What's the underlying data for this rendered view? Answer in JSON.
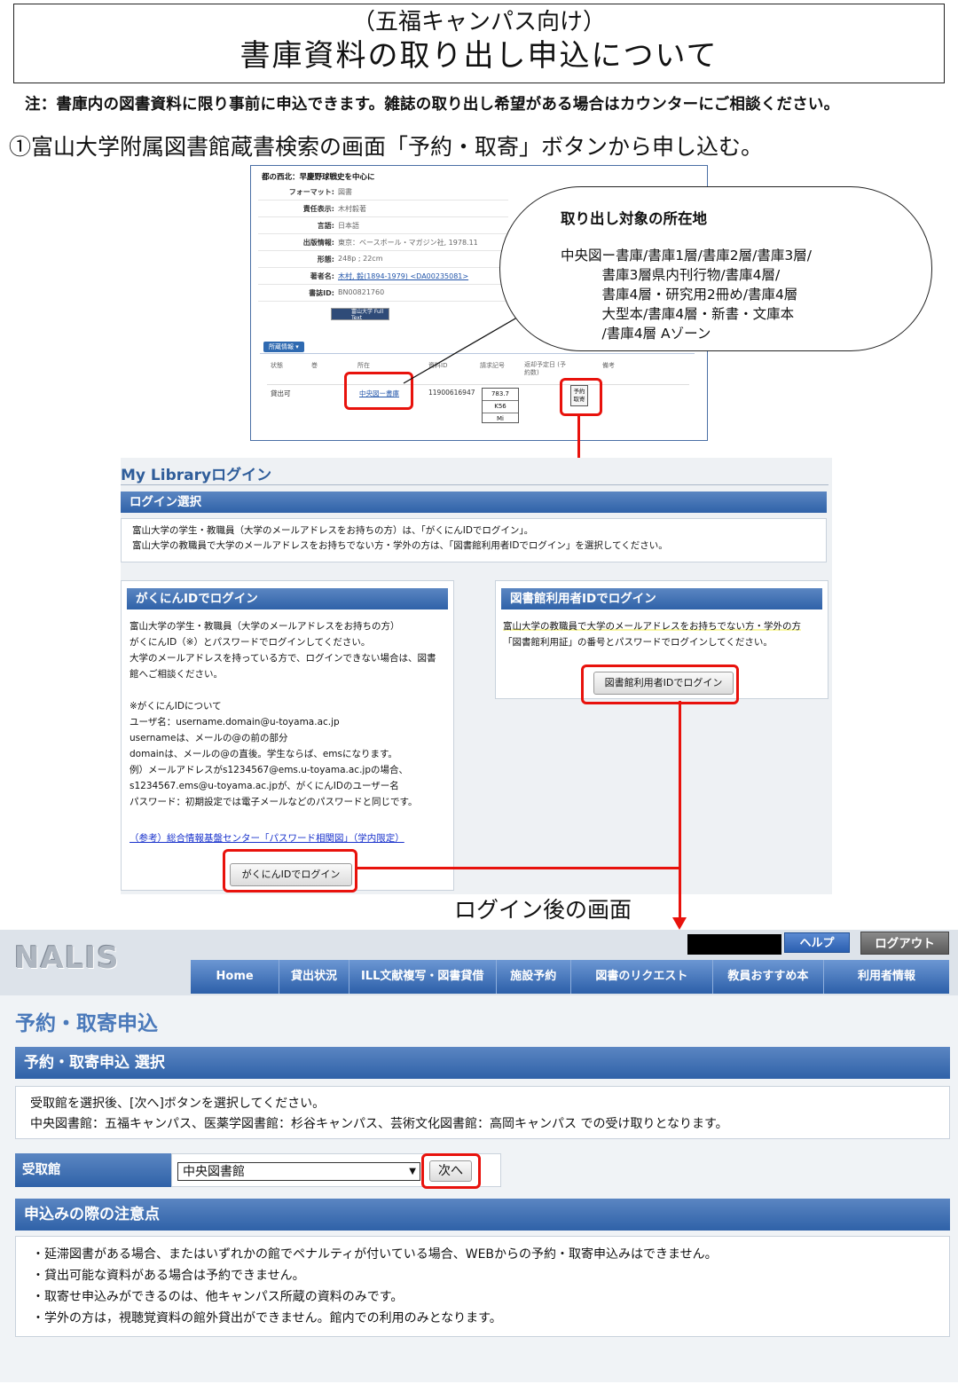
{
  "header": {
    "subtitle": "（五福キャンパス向け）",
    "title": "書庫資料の取り出し申込について",
    "note": "注：書庫内の図書資料に限り事前に申込できます。雑誌の取り出し希望がある場合はカウンターにご相談ください。",
    "step1": "①富山大学附属図書館蔵書検索の画面「予約・取寄」ボタンから申し込む。"
  },
  "catalog": {
    "title": "都の西北：早慶野球戦史を中心に",
    "fields": [
      {
        "label": "フォーマット:",
        "value": "図書"
      },
      {
        "label": "責任表示:",
        "value": "木村毅著"
      },
      {
        "label": "言語:",
        "value": "日本語"
      },
      {
        "label": "出版情報:",
        "value": "東京：ベースボール・マガジン社, 1978.11"
      },
      {
        "label": "形態:",
        "value": "248p ; 22cm"
      },
      {
        "label": "著者名:",
        "value": "木村, 毅(1894-1979) <DA00235081>"
      },
      {
        "label": "書誌ID:",
        "value": "BN00821760"
      }
    ],
    "fulltext_badge": "富山大学 Full Text",
    "holdings_tab": "所蔵情報",
    "holdings_headers": [
      "状態",
      "巻",
      "所在",
      "資料ID",
      "請求記号",
      "返却予定日 (予約数)",
      "備考"
    ],
    "holding_row": {
      "status": "貸出可",
      "location": "中央図ー書庫",
      "item_id": "11900616947",
      "call_number": [
        "783.7",
        "K56",
        "Mi"
      ],
      "reserve_button": "予約 取寄"
    }
  },
  "callout": {
    "title": "取り出し対象の所在地",
    "body": "中央図ー書庫/書庫1層/書庫2層/書庫3層/\n　　　書庫3層県内刊行物/書庫4層/\n　　　書庫4層・研究用2冊め/書庫4層\n　　　大型本/書庫4層・新書・文庫本\n　　　/書庫4層 Aゾーン"
  },
  "login": {
    "title": "My Libraryログイン",
    "section": "ログイン選択",
    "info_line1": "富山大学の学生・教職員（大学のメールアドレスをお持ちの方）は、「がくにんIDでログイン」。",
    "info_line2": "富山大学の教職員で大学のメールアドレスをお持ちでない方・学外の方は、「図書館利用者IDでログイン」を選択してください。",
    "gakunin": {
      "header": "がくにんIDでログイン",
      "body": "富山大学の学生・教職員（大学のメールアドレスをお持ちの方）\nがくにんID（※）とパスワードでログインしてください。\n大学のメールアドレスを持っている方で、ログインできない場合は、図書館へご相談ください。\n\n※がくにんIDについて\nユーザ名：username.domain@u-toyama.ac.jp\nusernameは、メールの@の前の部分\ndomainは、メールの@の直後。学生ならば、emsになります。\n例）メールアドレスがs1234567@ems.u-toyama.ac.jpの場合、s1234567.ems@u-toyama.ac.jpが、がくにんIDのユーザー名\nパスワード：初期設定では電子メールなどのパスワードと同じです。",
      "reference": "（参考）総合情報基盤センター「パスワード相関図」（学内限定）",
      "button": "がくにんIDでログイン"
    },
    "library_id": {
      "header": "図書館利用者IDでログイン",
      "body_highlight": "富山大学の教職員で大学のメールアドレスをお持ちでない方・学外の方",
      "body_rest": "「図書館利用証」の番号とパスワードでログインしてください。",
      "button": "図書館利用者IDでログイン"
    }
  },
  "after_login_label": "ログイン後の画面",
  "nalis": {
    "logo": "NALIS",
    "help": "ヘルプ",
    "logout": "ログアウト",
    "nav": [
      "Home",
      "貸出状況",
      "ILL文献複写・図書貸借",
      "施設予約",
      "図書のリクエスト",
      "教員おすすめ本",
      "利用者情報"
    ],
    "page_title": "予約・取寄申込",
    "section_select": "予約・取寄申込 選択",
    "info_line1": "受取館を選択後、[次へ]ボタンを選択してください。",
    "info_line2": "中央図書館：五福キャンパス、医薬学図書館：杉谷キャンパス、芸術文化図書館：高岡キャンパス での受け取りとなります。",
    "receive_label": "受取館",
    "receive_value": "中央図書館",
    "next_button": "次へ",
    "section_notes": "申込みの際の注意点",
    "notes": [
      "・延滞図書がある場合、またはいずれかの館でペナルティが付いている場合、WEBからの予約・取寄申込みはできません。",
      "・貸出可能な資料がある場合は予約できません。",
      "・取寄せ申込みができるのは、他キャンパス所蔵の資料のみです。",
      "・学外の方は，視聴覚資料の館外貸出ができません。館内での利用のみとなります。"
    ]
  },
  "colors": {
    "highlight_red": "#e8120c",
    "bar_blue": "#2f62a8",
    "title_blue": "#4a79ba"
  }
}
